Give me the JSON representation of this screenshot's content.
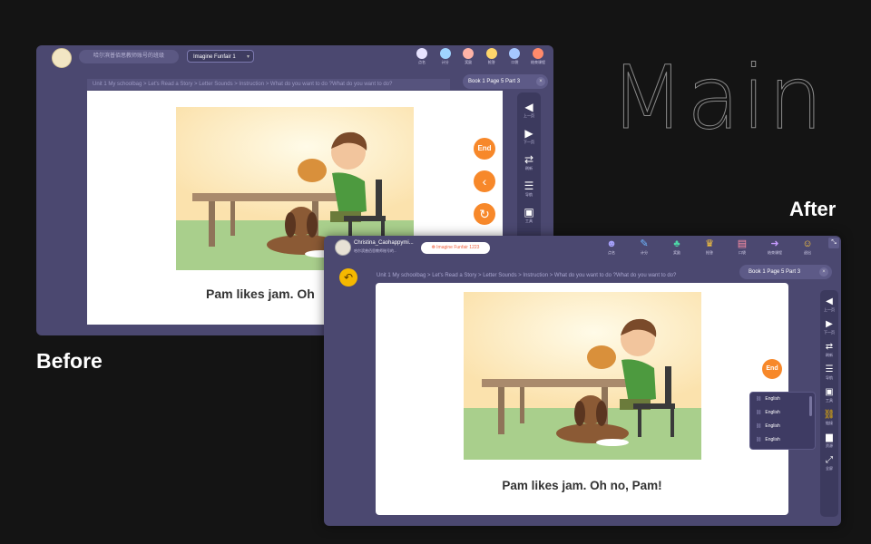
{
  "headings": {
    "main": "Main",
    "before": "Before",
    "after": "After"
  },
  "before": {
    "school_name": "哈尔滨普佰思教师账号的班级",
    "book_select": "Imagine Funfair 1",
    "top_icons": [
      {
        "label": "点名",
        "color": "#e7e3ff"
      },
      {
        "label": "计分",
        "color": "#9fd4ff"
      },
      {
        "label": "奖励",
        "color": "#ffb3a7"
      },
      {
        "label": "抢答",
        "color": "#ffd66b"
      },
      {
        "label": "口袋",
        "color": "#a6c8ff"
      },
      {
        "label": "结束课程",
        "color": "#ff8a6b"
      }
    ],
    "breadcrumb": "Unit 1 My schoolbag > Let's Read a Story > Letter Sounds > Instruction > What do you want to do ?What do you want to do?",
    "page_label": "Book 1 Page 5 Part 3",
    "close_icon": "×",
    "end_label": "End",
    "caption": "Pam likes jam. Oh",
    "rail": [
      {
        "icon": "◀",
        "label": "上一页"
      },
      {
        "icon": "▶",
        "label": "下一页"
      },
      {
        "icon": "⇄",
        "label": "刷新"
      },
      {
        "icon": "☰",
        "label": "导航"
      },
      {
        "icon": "▣",
        "label": "工具"
      }
    ]
  },
  "after": {
    "user_name": "Christina_Caohappymi...",
    "school_name": "哈尔滨普佰思教师账号的...",
    "book_pill": "Imagine Funfair 1223",
    "top_icons": [
      {
        "icon": "☻",
        "label": "点名",
        "color": "#a8a3ff"
      },
      {
        "icon": "✎",
        "label": "计分",
        "color": "#6fb6ff"
      },
      {
        "icon": "♣",
        "label": "奖励",
        "color": "#4dd6a6"
      },
      {
        "icon": "♛",
        "label": "抢答",
        "color": "#ffc93c"
      },
      {
        "icon": "▤",
        "label": "口袋",
        "color": "#ff8fa6"
      },
      {
        "icon": "➜",
        "label": "结束课程",
        "color": "#c79bff"
      },
      {
        "icon": "☺",
        "label": "退出",
        "color": "#ffc93c"
      }
    ],
    "breadcrumb": "Unit 1 My schoolbag > Let's Read a Story > Letter Sounds > Instruction > What do you want to do ?What do you want to do?",
    "page_label": "Book 1 Page 5 Part 3",
    "close_icon": "×",
    "end_label": "End",
    "caption": "Pam likes jam. Oh no, Pam!",
    "language_options": [
      "English",
      "English",
      "English",
      "English"
    ],
    "rail": [
      {
        "icon": "◀",
        "label": "上一页"
      },
      {
        "icon": "▶",
        "label": "下一页"
      },
      {
        "icon": "⇄",
        "label": "刷新"
      },
      {
        "icon": "☰",
        "label": "导航"
      },
      {
        "icon": "▣",
        "label": "工具"
      },
      {
        "icon": "⛓",
        "label": "链接"
      },
      {
        "icon": "▆",
        "label": "资源"
      },
      {
        "icon": "⤢",
        "label": "全屏"
      }
    ]
  }
}
